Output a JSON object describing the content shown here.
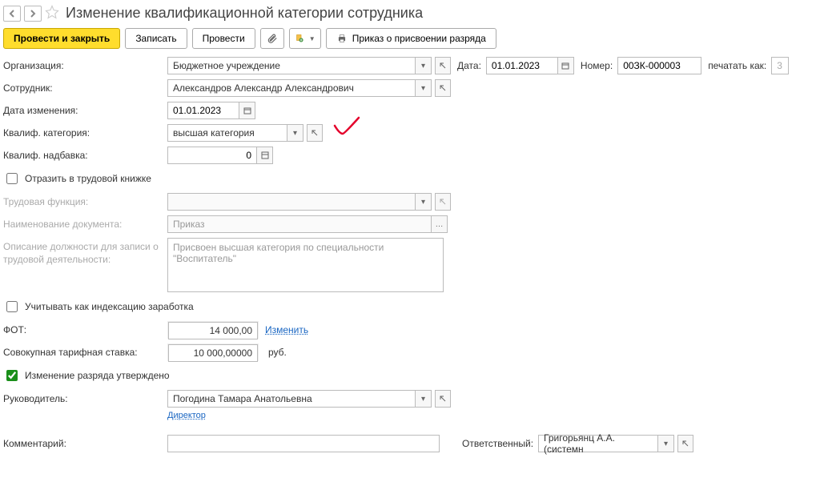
{
  "header": {
    "title": "Изменение квалификационной категории сотрудника"
  },
  "toolbar": {
    "post_close": "Провести и закрыть",
    "save": "Записать",
    "post": "Провести",
    "order_print": "Приказ о присвоении разряда"
  },
  "labels": {
    "org": "Организация:",
    "employee": "Сотрудник:",
    "change_date": "Дата изменения:",
    "qual_cat": "Квалиф. категория:",
    "qual_allow": "Квалиф. надбавка:",
    "labor_book": "Отразить в трудовой книжке",
    "labor_func": "Трудовая функция:",
    "doc_name": "Наименование документа:",
    "pos_desc": "Описание должности для записи о трудовой деятельности:",
    "indexation": "Учитывать как индексацию заработка",
    "fot": "ФОТ:",
    "tariff_rate": "Совокупная тарифная ставка:",
    "grade_approved": "Изменение разряда утверждено",
    "manager": "Руководитель:",
    "comment": "Комментарий:",
    "date": "Дата:",
    "number": "Номер:",
    "print_as": "печатать как:",
    "responsible": "Ответственный:",
    "change_link": "Изменить",
    "unit_rub": "руб."
  },
  "values": {
    "org": "Бюджетное учреждение",
    "employee": "Александров Александр Александрович",
    "change_date": "01.01.2023",
    "qual_cat": "высшая категория",
    "qual_allow": "0",
    "doc_name": "Приказ",
    "pos_desc": "Присвоен высшая категория по специальности \"Воспитатель\"",
    "fot": "14 000,00",
    "tariff_rate": "10 000,00000",
    "manager": "Погодина Тамара Анатольевна",
    "manager_title": "Директор",
    "doc_date": "01.01.2023",
    "doc_number": "00ЗК-000003",
    "print_as": "3",
    "responsible": "Григорьянц А.А. (системн",
    "labor_book_checked": false,
    "indexation_checked": false,
    "grade_approved_checked": true
  }
}
